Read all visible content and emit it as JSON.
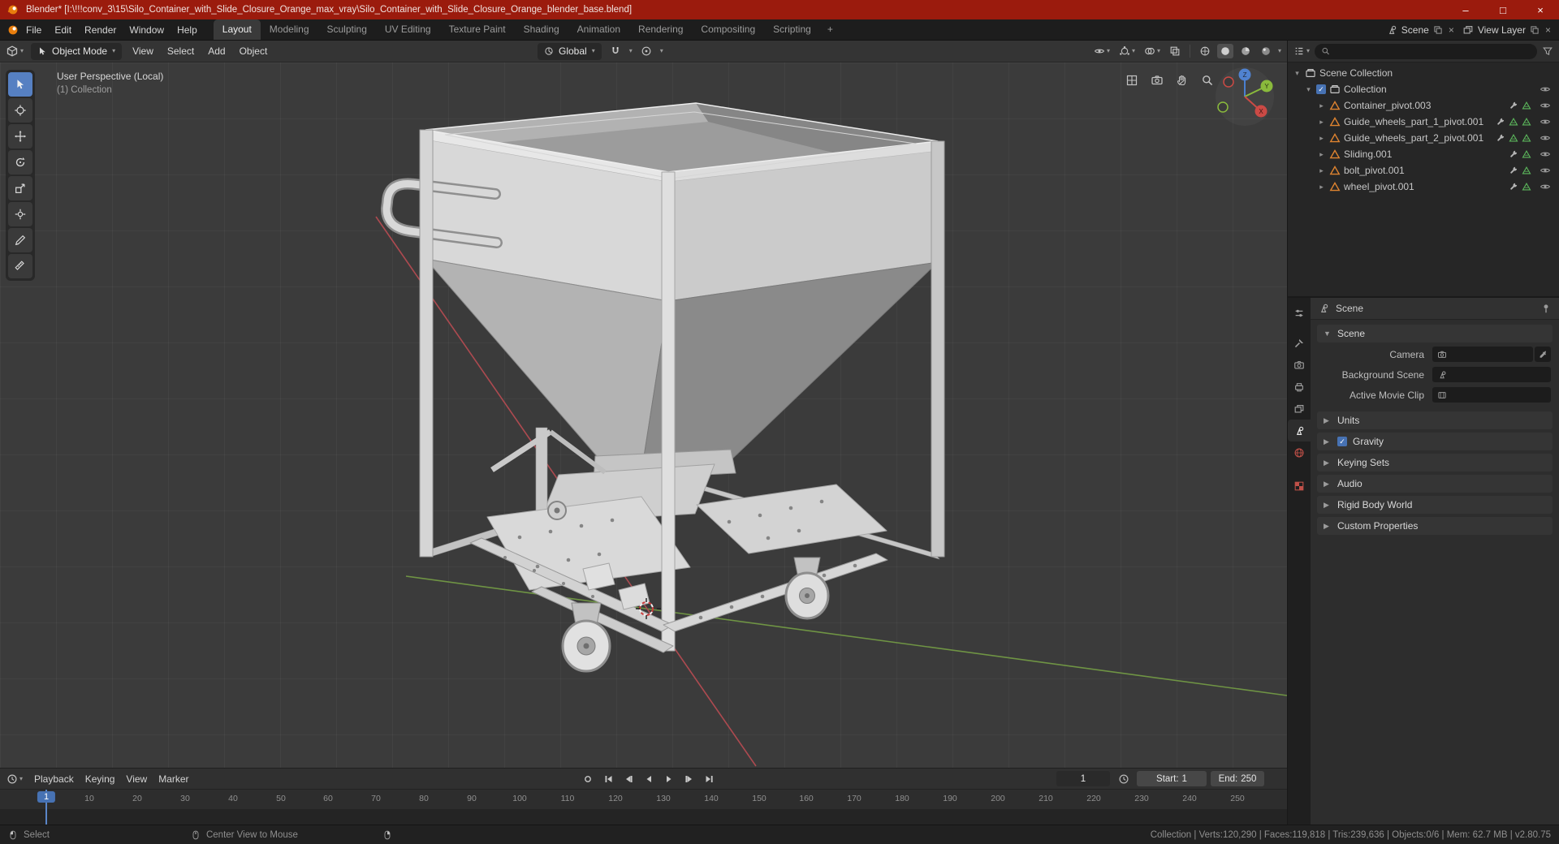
{
  "colors": {
    "accent": "#4772b3",
    "titlebar_red": "#9b1b0d",
    "object_orange": "#e08430",
    "data_green": "#5cb85c"
  },
  "window": {
    "title": "Blender* [I:\\!!!conv_3\\15\\Silo_Container_with_Slide_Closure_Orange_max_vray\\Silo_Container_with_Slide_Closure_Orange_blender_base.blend]",
    "minimize_glyph": "–",
    "maximize_glyph": "□",
    "close_glyph": "×"
  },
  "topbar": {
    "menus": [
      "File",
      "Edit",
      "Render",
      "Window",
      "Help"
    ],
    "tabs": [
      "Layout",
      "Modeling",
      "Sculpting",
      "UV Editing",
      "Texture Paint",
      "Shading",
      "Animation",
      "Rendering",
      "Compositing",
      "Scripting"
    ],
    "active_tab": "Layout",
    "add_tab_glyph": "+",
    "scene_selector": "Scene",
    "view_layer_selector": "View Layer"
  },
  "viewport_header": {
    "mode": "Object Mode",
    "menus": [
      "View",
      "Select",
      "Add",
      "Object"
    ],
    "transform_orientation": "Global"
  },
  "viewport": {
    "overlay_title": "User Perspective (Local)",
    "overlay_subtitle": "(1) Collection",
    "gizmo_axes": {
      "x": "X",
      "y": "Y",
      "z": "Z"
    },
    "tools": [
      "tweak-select",
      "cursor",
      "move",
      "rotate",
      "scale",
      "transform",
      "annotate",
      "measure"
    ]
  },
  "outliner": {
    "search_placeholder": "",
    "rows": [
      {
        "label": "Scene Collection",
        "depth": 0,
        "icon": "collection"
      },
      {
        "label": "Collection",
        "depth": 1,
        "icon": "collection",
        "checked": true
      },
      {
        "label": "Container_pivot.003",
        "depth": 2,
        "icon": "mesh-object"
      },
      {
        "label": "Guide_wheels_part_1_pivot.001",
        "depth": 2,
        "icon": "mesh-object"
      },
      {
        "label": "Guide_wheels_part_2_pivot.001",
        "depth": 2,
        "icon": "mesh-object"
      },
      {
        "label": "Sliding.001",
        "depth": 2,
        "icon": "mesh-object"
      },
      {
        "label": "bolt_pivot.001",
        "depth": 2,
        "icon": "mesh-object"
      },
      {
        "label": "wheel_pivot.001",
        "depth": 2,
        "icon": "mesh-object"
      }
    ]
  },
  "properties": {
    "breadcrumb": "Scene",
    "section_title": "Scene",
    "fields": [
      {
        "label": "Camera",
        "value": ""
      },
      {
        "label": "Background Scene",
        "value": ""
      },
      {
        "label": "Active Movie Clip",
        "value": ""
      }
    ],
    "panels": [
      {
        "label": "Units"
      },
      {
        "label": "Gravity",
        "checked": true
      },
      {
        "label": "Keying Sets"
      },
      {
        "label": "Audio"
      },
      {
        "label": "Rigid Body World"
      },
      {
        "label": "Custom Properties"
      }
    ],
    "tabs": [
      "tool",
      "render",
      "output",
      "view-layer",
      "scene",
      "world",
      "texture"
    ],
    "active_tab": "scene"
  },
  "timeline": {
    "menus": [
      "Playback",
      "Keying",
      "View",
      "Marker"
    ],
    "transport": [
      "auto-key",
      "jump-start",
      "prev-keyframe",
      "play-reverse",
      "play",
      "next-keyframe",
      "jump-end"
    ],
    "current_frame": "1",
    "start_label": "Start:",
    "start_value": "1",
    "end_label": "End:",
    "end_value": "250",
    "ticks": [
      10,
      20,
      30,
      40,
      50,
      60,
      70,
      80,
      90,
      100,
      110,
      120,
      130,
      140,
      150,
      160,
      170,
      180,
      190,
      200,
      210,
      220,
      230,
      240,
      250
    ]
  },
  "status_bar": {
    "left_hint": "Select",
    "middle_hint": "Center View to Mouse",
    "stats": "Collection | Verts:120,290 | Faces:119,818 | Tris:239,636 | Objects:0/6 | Mem: 62.7 MB | v2.80.75"
  }
}
